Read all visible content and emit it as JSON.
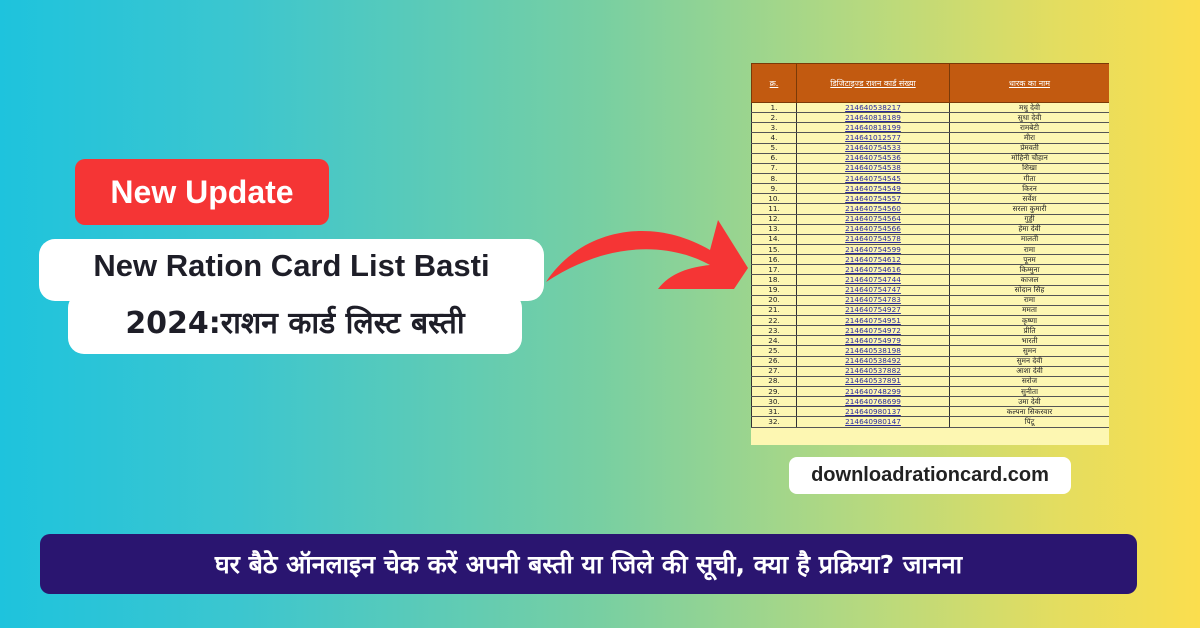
{
  "badge": {
    "label": "New Update",
    "color": "#f53535"
  },
  "title": {
    "line1": "New Ration Card List Basti",
    "line2": "2024:राशन कार्ड लिस्ट बस्ती"
  },
  "arrow": {
    "icon": "curved-arrow-right",
    "color": "#f53535"
  },
  "table": {
    "headers": [
      "क्र.",
      "डिजिटाइज्ड राशन कार्ड संख्या",
      "धारक का नाम"
    ],
    "header_color": "#c25a10",
    "row_color": "#fdf7b2",
    "rows": [
      [
        "1.",
        "214640538217",
        "मधु देवी"
      ],
      [
        "2.",
        "214640818189",
        "सुधा देवी"
      ],
      [
        "3.",
        "214640818199",
        "रामबेटी"
      ],
      [
        "4.",
        "214641012577",
        "मीरा"
      ],
      [
        "5.",
        "214640754533",
        "प्रेमवती"
      ],
      [
        "6.",
        "214640754536",
        "मोहिनी चौहान"
      ],
      [
        "7.",
        "214640754538",
        "शिखा"
      ],
      [
        "8.",
        "214640754545",
        "गीता"
      ],
      [
        "9.",
        "214640754549",
        "किरन"
      ],
      [
        "10.",
        "214640754557",
        "सर्वेश"
      ],
      [
        "11.",
        "214640754560",
        "सरला कुमारी"
      ],
      [
        "12.",
        "214640754564",
        "गुड्डी"
      ],
      [
        "13.",
        "214640754566",
        "हेमा देवी"
      ],
      [
        "14.",
        "214640754578",
        "मालती"
      ],
      [
        "15.",
        "214640754599",
        "रामा"
      ],
      [
        "16.",
        "214640754612",
        "पूनम"
      ],
      [
        "17.",
        "214640754616",
        "किम्मुना"
      ],
      [
        "18.",
        "214640754744",
        "काजल"
      ],
      [
        "19.",
        "214640754747",
        "सोदान सिंह"
      ],
      [
        "20.",
        "214640754783",
        "रामा"
      ],
      [
        "21.",
        "214640754927",
        "ममता"
      ],
      [
        "22.",
        "214640754951",
        "कृष्णा"
      ],
      [
        "23.",
        "214640754972",
        "प्रीति"
      ],
      [
        "24.",
        "214640754979",
        "भारती"
      ],
      [
        "25.",
        "214640538198",
        "सुमन"
      ],
      [
        "26.",
        "214640538492",
        "सुमन देवी"
      ],
      [
        "27.",
        "214640537882",
        "आशा देवी"
      ],
      [
        "28.",
        "214640537891",
        "सरोज"
      ],
      [
        "29.",
        "214640748299",
        "सुनीता"
      ],
      [
        "30.",
        "214640768699",
        "उमा देवी"
      ],
      [
        "31.",
        "214640980137",
        "कल्पना सिकरवार"
      ],
      [
        "32.",
        "214640980147",
        "पिंटू"
      ]
    ]
  },
  "site": {
    "label": "downloadrationcard.com"
  },
  "bottom_banner": {
    "text": "घर बैठे ऑनलाइन चेक करें अपनी बस्ती या जिले की सूची, क्या है प्रक्रिया? जानना",
    "color": "#2a1570"
  }
}
